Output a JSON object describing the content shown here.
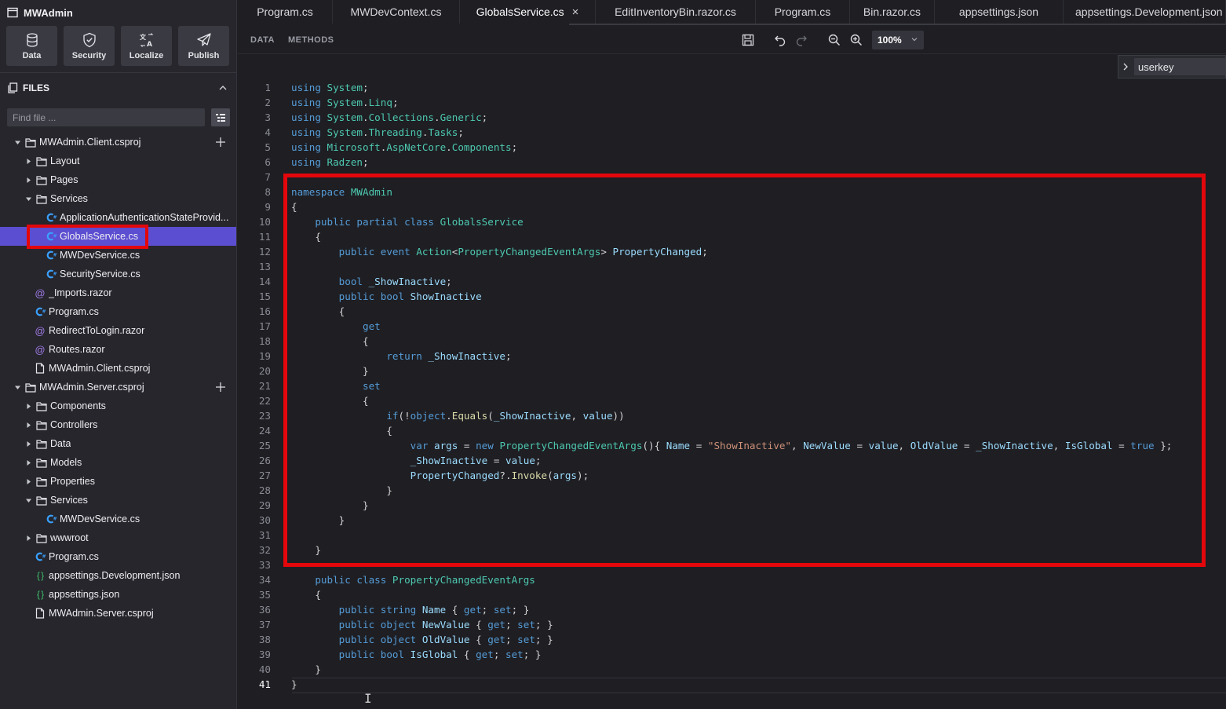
{
  "app": {
    "title": "MWAdmin"
  },
  "toolbar": {
    "buttons": [
      {
        "label": "Data",
        "icon": "database-icon"
      },
      {
        "label": "Security",
        "icon": "shield-check-icon"
      },
      {
        "label": "Localize",
        "icon": "translate-icon"
      },
      {
        "label": "Publish",
        "icon": "paper-plane-icon"
      }
    ]
  },
  "files": {
    "header": "FILES",
    "search_placeholder": "Find file ...",
    "tree": [
      {
        "label": "MWAdmin.Client.csproj",
        "depth": 0,
        "type": "folder",
        "expanded": true,
        "add": true
      },
      {
        "label": "Layout",
        "depth": 1,
        "type": "folder",
        "expanded": false
      },
      {
        "label": "Pages",
        "depth": 1,
        "type": "folder",
        "expanded": false
      },
      {
        "label": "Services",
        "depth": 1,
        "type": "folder",
        "expanded": true
      },
      {
        "label": "ApplicationAuthenticationStateProvid...",
        "depth": 2,
        "type": "cs"
      },
      {
        "label": "GlobalsService.cs",
        "depth": 2,
        "type": "cs",
        "selected": true
      },
      {
        "label": "MWDevService.cs",
        "depth": 2,
        "type": "cs"
      },
      {
        "label": "SecurityService.cs",
        "depth": 2,
        "type": "cs"
      },
      {
        "label": "_Imports.razor",
        "depth": 1,
        "type": "razor"
      },
      {
        "label": "Program.cs",
        "depth": 1,
        "type": "cs"
      },
      {
        "label": "RedirectToLogin.razor",
        "depth": 1,
        "type": "razor"
      },
      {
        "label": "Routes.razor",
        "depth": 1,
        "type": "razor"
      },
      {
        "label": "MWAdmin.Client.csproj",
        "depth": 1,
        "type": "file"
      },
      {
        "label": "MWAdmin.Server.csproj",
        "depth": 0,
        "type": "folder",
        "expanded": true,
        "add": true
      },
      {
        "label": "Components",
        "depth": 1,
        "type": "folder",
        "expanded": false
      },
      {
        "label": "Controllers",
        "depth": 1,
        "type": "folder",
        "expanded": false
      },
      {
        "label": "Data",
        "depth": 1,
        "type": "folder",
        "expanded": false
      },
      {
        "label": "Models",
        "depth": 1,
        "type": "folder",
        "expanded": false
      },
      {
        "label": "Properties",
        "depth": 1,
        "type": "folder",
        "expanded": false
      },
      {
        "label": "Services",
        "depth": 1,
        "type": "folder",
        "expanded": true
      },
      {
        "label": "MWDevService.cs",
        "depth": 2,
        "type": "cs"
      },
      {
        "label": "wwwroot",
        "depth": 1,
        "type": "folder",
        "expanded": false
      },
      {
        "label": "Program.cs",
        "depth": 1,
        "type": "cs"
      },
      {
        "label": "appsettings.Development.json",
        "depth": 1,
        "type": "json"
      },
      {
        "label": "appsettings.json",
        "depth": 1,
        "type": "json"
      },
      {
        "label": "MWAdmin.Server.csproj",
        "depth": 1,
        "type": "file"
      }
    ]
  },
  "tabs": [
    {
      "label": "Program.cs"
    },
    {
      "label": "MWDevContext.cs"
    },
    {
      "label": "GlobalsService.cs",
      "active": true,
      "closable": true,
      "close": "×"
    },
    {
      "label": "EditInventoryBin.razor.cs"
    },
    {
      "label": "Program.cs"
    },
    {
      "label": "Bin.razor.cs"
    },
    {
      "label": "appsettings.json"
    },
    {
      "label": "appsettings.Development.json"
    }
  ],
  "editor": {
    "view_tabs": [
      "DATA",
      "METHODS"
    ],
    "zoom": "100%",
    "find_value": "userkey",
    "current_line": 41,
    "lines": [
      [
        [
          "kw",
          "using "
        ],
        [
          "ty",
          "System"
        ],
        [
          "p",
          ";"
        ]
      ],
      [
        [
          "kw",
          "using "
        ],
        [
          "ty",
          "System"
        ],
        [
          "p",
          "."
        ],
        [
          "ty",
          "Linq"
        ],
        [
          "p",
          ";"
        ]
      ],
      [
        [
          "kw",
          "using "
        ],
        [
          "ty",
          "System"
        ],
        [
          "p",
          "."
        ],
        [
          "ty",
          "Collections"
        ],
        [
          "p",
          "."
        ],
        [
          "ty",
          "Generic"
        ],
        [
          "p",
          ";"
        ]
      ],
      [
        [
          "kw",
          "using "
        ],
        [
          "ty",
          "System"
        ],
        [
          "p",
          "."
        ],
        [
          "ty",
          "Threading"
        ],
        [
          "p",
          "."
        ],
        [
          "ty",
          "Tasks"
        ],
        [
          "p",
          ";"
        ]
      ],
      [
        [
          "kw",
          "using "
        ],
        [
          "ty",
          "Microsoft"
        ],
        [
          "p",
          "."
        ],
        [
          "ty",
          "AspNetCore"
        ],
        [
          "p",
          "."
        ],
        [
          "ty",
          "Components"
        ],
        [
          "p",
          ";"
        ]
      ],
      [
        [
          "kw",
          "using "
        ],
        [
          "ty",
          "Radzen"
        ],
        [
          "p",
          ";"
        ]
      ],
      [],
      [
        [
          "kw",
          "namespace "
        ],
        [
          "ty",
          "MWAdmin"
        ]
      ],
      [
        [
          "p",
          "{"
        ]
      ],
      [
        [
          "p",
          "    "
        ],
        [
          "kw",
          "public partial class "
        ],
        [
          "ty",
          "GlobalsService"
        ]
      ],
      [
        [
          "p",
          "    {"
        ]
      ],
      [
        [
          "p",
          "        "
        ],
        [
          "kw",
          "public event "
        ],
        [
          "ty",
          "Action"
        ],
        [
          "p",
          "<"
        ],
        [
          "ty",
          "PropertyChangedEventArgs"
        ],
        [
          "p",
          "> "
        ],
        [
          "id",
          "PropertyChanged"
        ],
        [
          "p",
          ";"
        ]
      ],
      [],
      [
        [
          "p",
          "        "
        ],
        [
          "kw",
          "bool "
        ],
        [
          "id",
          "_ShowInactive"
        ],
        [
          "p",
          ";"
        ]
      ],
      [
        [
          "p",
          "        "
        ],
        [
          "kw",
          "public bool "
        ],
        [
          "id",
          "ShowInactive"
        ]
      ],
      [
        [
          "p",
          "        {"
        ]
      ],
      [
        [
          "p",
          "            "
        ],
        [
          "kw",
          "get"
        ]
      ],
      [
        [
          "p",
          "            {"
        ]
      ],
      [
        [
          "p",
          "                "
        ],
        [
          "kw",
          "return "
        ],
        [
          "id",
          "_ShowInactive"
        ],
        [
          "p",
          ";"
        ]
      ],
      [
        [
          "p",
          "            }"
        ]
      ],
      [
        [
          "p",
          "            "
        ],
        [
          "kw",
          "set"
        ]
      ],
      [
        [
          "p",
          "            {"
        ]
      ],
      [
        [
          "p",
          "                "
        ],
        [
          "kw",
          "if"
        ],
        [
          "p",
          "(!"
        ],
        [
          "kw",
          "object"
        ],
        [
          "p",
          "."
        ],
        [
          "fn",
          "Equals"
        ],
        [
          "p",
          "("
        ],
        [
          "id",
          "_ShowInactive"
        ],
        [
          "p",
          ", "
        ],
        [
          "id",
          "value"
        ],
        [
          "p",
          "))"
        ]
      ],
      [
        [
          "p",
          "                {"
        ]
      ],
      [
        [
          "p",
          "                    "
        ],
        [
          "kw",
          "var "
        ],
        [
          "id",
          "args"
        ],
        [
          "p",
          " = "
        ],
        [
          "kw",
          "new "
        ],
        [
          "ty",
          "PropertyChangedEventArgs"
        ],
        [
          "p",
          "(){ "
        ],
        [
          "id",
          "Name"
        ],
        [
          "p",
          " = "
        ],
        [
          "st",
          "\"ShowInactive\""
        ],
        [
          "p",
          ", "
        ],
        [
          "id",
          "NewValue"
        ],
        [
          "p",
          " = "
        ],
        [
          "id",
          "value"
        ],
        [
          "p",
          ", "
        ],
        [
          "id",
          "OldValue"
        ],
        [
          "p",
          " = "
        ],
        [
          "id",
          "_ShowInactive"
        ],
        [
          "p",
          ", "
        ],
        [
          "id",
          "IsGlobal"
        ],
        [
          "p",
          " = "
        ],
        [
          "kw",
          "true"
        ],
        [
          "p",
          " };"
        ]
      ],
      [
        [
          "p",
          "                    "
        ],
        [
          "id",
          "_ShowInactive"
        ],
        [
          "p",
          " = "
        ],
        [
          "id",
          "value"
        ],
        [
          "p",
          ";"
        ]
      ],
      [
        [
          "p",
          "                    "
        ],
        [
          "id",
          "PropertyChanged"
        ],
        [
          "p",
          "?."
        ],
        [
          "fn",
          "Invoke"
        ],
        [
          "p",
          "("
        ],
        [
          "id",
          "args"
        ],
        [
          "p",
          ");"
        ]
      ],
      [
        [
          "p",
          "                }"
        ]
      ],
      [
        [
          "p",
          "            }"
        ]
      ],
      [
        [
          "p",
          "        }"
        ]
      ],
      [],
      [
        [
          "p",
          "    }"
        ]
      ],
      [],
      [
        [
          "p",
          "    "
        ],
        [
          "kw",
          "public class "
        ],
        [
          "ty",
          "PropertyChangedEventArgs"
        ]
      ],
      [
        [
          "p",
          "    {"
        ]
      ],
      [
        [
          "p",
          "        "
        ],
        [
          "kw",
          "public string "
        ],
        [
          "id",
          "Name"
        ],
        [
          "p",
          " { "
        ],
        [
          "kw",
          "get"
        ],
        [
          "p",
          "; "
        ],
        [
          "kw",
          "set"
        ],
        [
          "p",
          "; }"
        ]
      ],
      [
        [
          "p",
          "        "
        ],
        [
          "kw",
          "public object "
        ],
        [
          "id",
          "NewValue"
        ],
        [
          "p",
          " { "
        ],
        [
          "kw",
          "get"
        ],
        [
          "p",
          "; "
        ],
        [
          "kw",
          "set"
        ],
        [
          "p",
          "; }"
        ]
      ],
      [
        [
          "p",
          "        "
        ],
        [
          "kw",
          "public object "
        ],
        [
          "id",
          "OldValue"
        ],
        [
          "p",
          " { "
        ],
        [
          "kw",
          "get"
        ],
        [
          "p",
          "; "
        ],
        [
          "kw",
          "set"
        ],
        [
          "p",
          "; }"
        ]
      ],
      [
        [
          "p",
          "        "
        ],
        [
          "kw",
          "public bool "
        ],
        [
          "id",
          "IsGlobal"
        ],
        [
          "p",
          " { "
        ],
        [
          "kw",
          "get"
        ],
        [
          "p",
          "; "
        ],
        [
          "kw",
          "set"
        ],
        [
          "p",
          "; }"
        ]
      ],
      [
        [
          "p",
          "    }"
        ]
      ],
      [
        [
          "p",
          "}"
        ]
      ]
    ]
  },
  "colors": {
    "selection": "#5c4ed1",
    "annotation_box": "#e3070c",
    "keyword": "#569cd6",
    "type": "#4ec9b0",
    "string": "#ce9178",
    "identifier": "#9cdcfe",
    "method": "#dcdcaa"
  }
}
